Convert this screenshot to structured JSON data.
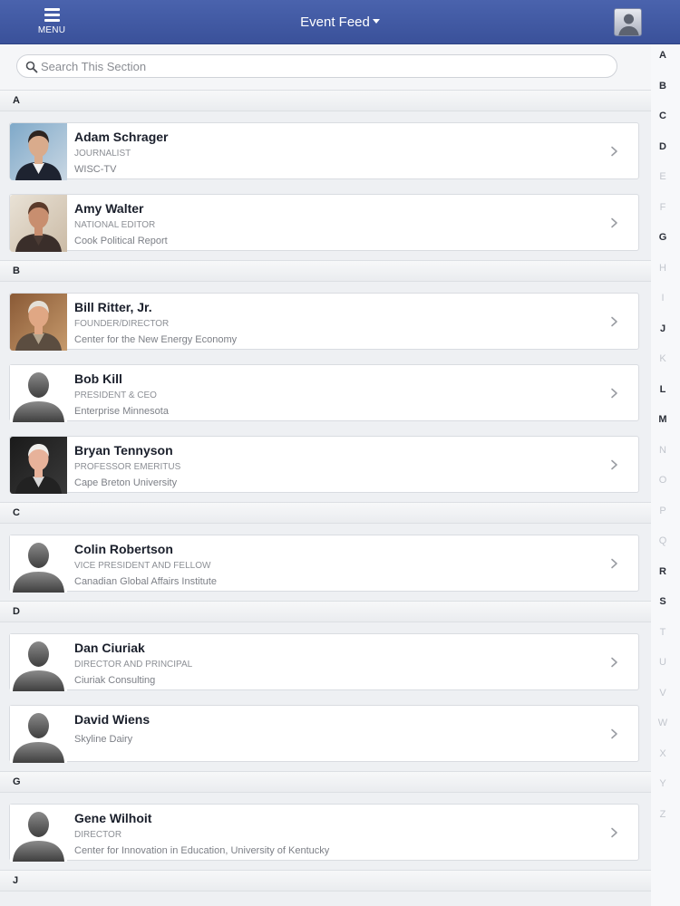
{
  "header": {
    "menu_label": "MENU",
    "title": "Event Feed"
  },
  "search": {
    "placeholder": "Search This Section"
  },
  "index_letters": [
    {
      "letter": "A",
      "active": true
    },
    {
      "letter": "B",
      "active": true
    },
    {
      "letter": "C",
      "active": true
    },
    {
      "letter": "D",
      "active": true
    },
    {
      "letter": "E",
      "active": false
    },
    {
      "letter": "F",
      "active": false
    },
    {
      "letter": "G",
      "active": true
    },
    {
      "letter": "H",
      "active": false
    },
    {
      "letter": "I",
      "active": false
    },
    {
      "letter": "J",
      "active": true
    },
    {
      "letter": "K",
      "active": false
    },
    {
      "letter": "L",
      "active": true
    },
    {
      "letter": "M",
      "active": true
    },
    {
      "letter": "N",
      "active": false
    },
    {
      "letter": "O",
      "active": false
    },
    {
      "letter": "P",
      "active": false
    },
    {
      "letter": "Q",
      "active": false
    },
    {
      "letter": "R",
      "active": true
    },
    {
      "letter": "S",
      "active": true
    },
    {
      "letter": "T",
      "active": false
    },
    {
      "letter": "U",
      "active": false
    },
    {
      "letter": "V",
      "active": false
    },
    {
      "letter": "W",
      "active": false
    },
    {
      "letter": "X",
      "active": false
    },
    {
      "letter": "Y",
      "active": false
    },
    {
      "letter": "Z",
      "active": false
    }
  ],
  "sections": [
    {
      "letter": "A",
      "people": [
        {
          "name": "Adam Schrager",
          "title": "JOURNALIST",
          "org": "WISC-TV",
          "photo": "headshot-photo"
        },
        {
          "name": "Amy Walter",
          "title": "NATIONAL EDITOR",
          "org": "Cook Political Report",
          "photo": "headshot-photo"
        }
      ]
    },
    {
      "letter": "B",
      "people": [
        {
          "name": "Bill Ritter, Jr.",
          "title": "FOUNDER/DIRECTOR",
          "org": "Center for the New Energy Economy",
          "photo": "headshot-photo"
        },
        {
          "name": "Bob Kill",
          "title": "PRESIDENT & CEO",
          "org": "Enterprise Minnesota",
          "photo": "placeholder-avatar"
        },
        {
          "name": "Bryan Tennyson",
          "title": "PROFESSOR EMERITUS",
          "org": "Cape Breton University",
          "photo": "headshot-photo"
        }
      ]
    },
    {
      "letter": "C",
      "people": [
        {
          "name": "Colin Robertson",
          "title": "VICE PRESIDENT AND FELLOW",
          "org": "Canadian Global Affairs Institute",
          "photo": "placeholder-avatar"
        }
      ]
    },
    {
      "letter": "D",
      "people": [
        {
          "name": "Dan Ciuriak",
          "title": "DIRECTOR AND PRINCIPAL",
          "org": "Ciuriak Consulting",
          "photo": "placeholder-avatar"
        },
        {
          "name": "David Wiens",
          "title": "",
          "org": "Skyline Dairy",
          "photo": "placeholder-avatar"
        }
      ]
    },
    {
      "letter": "G",
      "people": [
        {
          "name": "Gene Wilhoit",
          "title": "DIRECTOR",
          "org": "Center for Innovation in Education, University of Kentucky",
          "photo": "placeholder-avatar"
        }
      ]
    },
    {
      "letter": "J",
      "people": []
    }
  ]
}
